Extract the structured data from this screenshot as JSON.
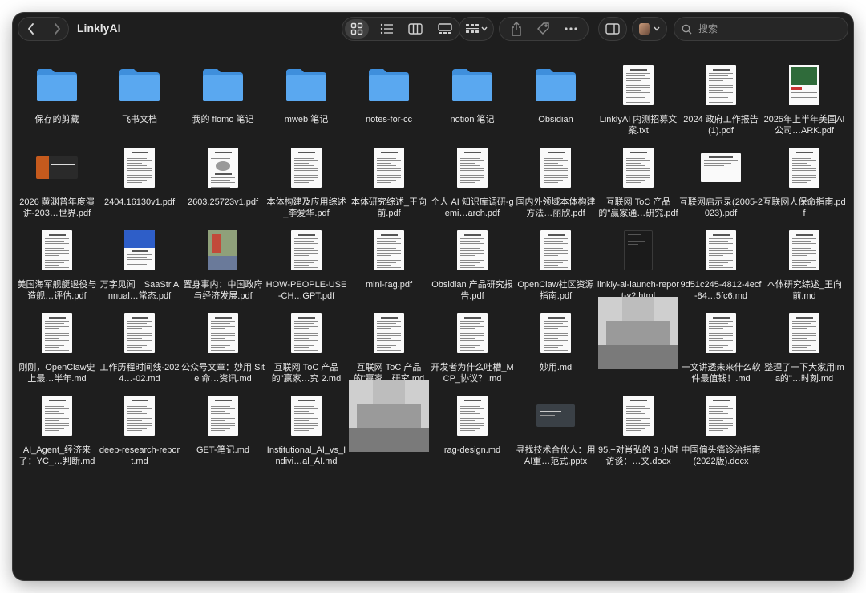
{
  "window": {
    "title": "LinklyAI"
  },
  "search": {
    "placeholder": "搜索"
  },
  "colors": {
    "folder": "#5AA8F0",
    "folder_dark": "#3F8FDC",
    "bg": "#1E1E1E"
  },
  "toolbar": {
    "view_icons": [
      "grid-view-icon",
      "list-view-icon",
      "column-view-icon",
      "gallery-view-icon"
    ],
    "group_icon": "group-by-icon",
    "share_icon": "share-icon",
    "tag_icon": "tag-icon",
    "more_icon": "more-icon",
    "sidebar_icon": "sidebar-toggle-icon",
    "profile_icon": "profile-icon"
  },
  "files": [
    {
      "label": "保存的剪藏",
      "type": "folder"
    },
    {
      "label": "飞书文档",
      "type": "folder"
    },
    {
      "label": "我的 flomo 笔记",
      "type": "folder"
    },
    {
      "label": "mweb 笔记",
      "type": "folder"
    },
    {
      "label": "notes-for-cc",
      "type": "folder"
    },
    {
      "label": "notion 笔记",
      "type": "folder"
    },
    {
      "label": "Obsidian",
      "type": "folder"
    },
    {
      "label": "LinklyAI 内测招募文案.txt",
      "type": "doc"
    },
    {
      "label": "2024 政府工作报告(1).pdf",
      "type": "doc"
    },
    {
      "label": "2025年上半年美国AI公司…ARK.pdf",
      "type": "doc-green"
    },
    {
      "label": "2026 黄渊普年度演讲-203…世界.pdf",
      "type": "slide-dark"
    },
    {
      "label": "2404.16130v1.pdf",
      "type": "doc"
    },
    {
      "label": "2603.25723v1.pdf",
      "type": "doc-fig"
    },
    {
      "label": "本体构建及应用综述_李爱华.pdf",
      "type": "doc"
    },
    {
      "label": "本体研究综述_王向前.pdf",
      "type": "doc"
    },
    {
      "label": "个人 AI 知识库调研-gemi…arch.pdf",
      "type": "doc"
    },
    {
      "label": "国内外领域本体构建方法…丽欣.pdf",
      "type": "doc"
    },
    {
      "label": "互联网 ToC 产品的\"赢家通…研究.pdf",
      "type": "doc"
    },
    {
      "label": "互联网启示录(2005-2023).pdf",
      "type": "doc-land"
    },
    {
      "label": "互联网人保命指南.pdf",
      "type": "doc"
    },
    {
      "label": "美国海军舰艇退役与造舰…评估.pdf",
      "type": "doc"
    },
    {
      "label": "万字见闻｜SaaStr Annual…常态.pdf",
      "type": "doc-blue"
    },
    {
      "label": "置身事内：中国政府与经济发展.pdf",
      "type": "book"
    },
    {
      "label": "HOW-PEOPLE-USE-CH…GPT.pdf",
      "type": "doc"
    },
    {
      "label": "mini-rag.pdf",
      "type": "doc"
    },
    {
      "label": "Obsidian 产品研究报告.pdf",
      "type": "doc"
    },
    {
      "label": "OpenClaw社区资源指南.pdf",
      "type": "doc"
    },
    {
      "label": "linkly-ai-launch-report-v2.html",
      "type": "phone"
    },
    {
      "label": "9d51c245-4812-4ecf-84…5fc6.md",
      "type": "doc"
    },
    {
      "label": "本体研究综述_王向前.md",
      "type": "doc"
    },
    {
      "label": "刚刚，OpenClaw史上最…半年.md",
      "type": "doc"
    },
    {
      "label": "工作历程时间线-2024…-02.md",
      "type": "doc"
    },
    {
      "label": "公众号文章：妙用 Site 命…资讯.md",
      "type": "doc"
    },
    {
      "label": "互联网 ToC 产品的\"赢家…究 2.md",
      "type": "doc"
    },
    {
      "label": "互联网 ToC 产品的\"赢家…研究.md",
      "type": "doc"
    },
    {
      "label": "开发者为什么吐槽_MCP_协议？.md",
      "type": "doc"
    },
    {
      "label": "妙用.md",
      "type": "doc"
    },
    {
      "label": "",
      "type": "blurred"
    },
    {
      "label": "一文讲透未来什么软件最值钱！.md",
      "type": "doc"
    },
    {
      "label": "整理了一下大家用ima的\"…时刻.md",
      "type": "doc"
    },
    {
      "label": "AI_Agent_经济来了：YC_…判断.md",
      "type": "doc"
    },
    {
      "label": "deep-research-report.md",
      "type": "doc"
    },
    {
      "label": "GET-笔记.md",
      "type": "doc"
    },
    {
      "label": "Institutional_AI_vs_Indivi…al_AI.md",
      "type": "doc"
    },
    {
      "label": "",
      "type": "blurred"
    },
    {
      "label": "rag-design.md",
      "type": "doc"
    },
    {
      "label": "寻找技术合伙人：用AI重…范式.pptx",
      "type": "pptx"
    },
    {
      "label": "95.+对肖弘的 3 小时访谈：…文.docx",
      "type": "doc"
    },
    {
      "label": "中国偏头痛诊治指南(2022版).docx",
      "type": "doc"
    }
  ]
}
